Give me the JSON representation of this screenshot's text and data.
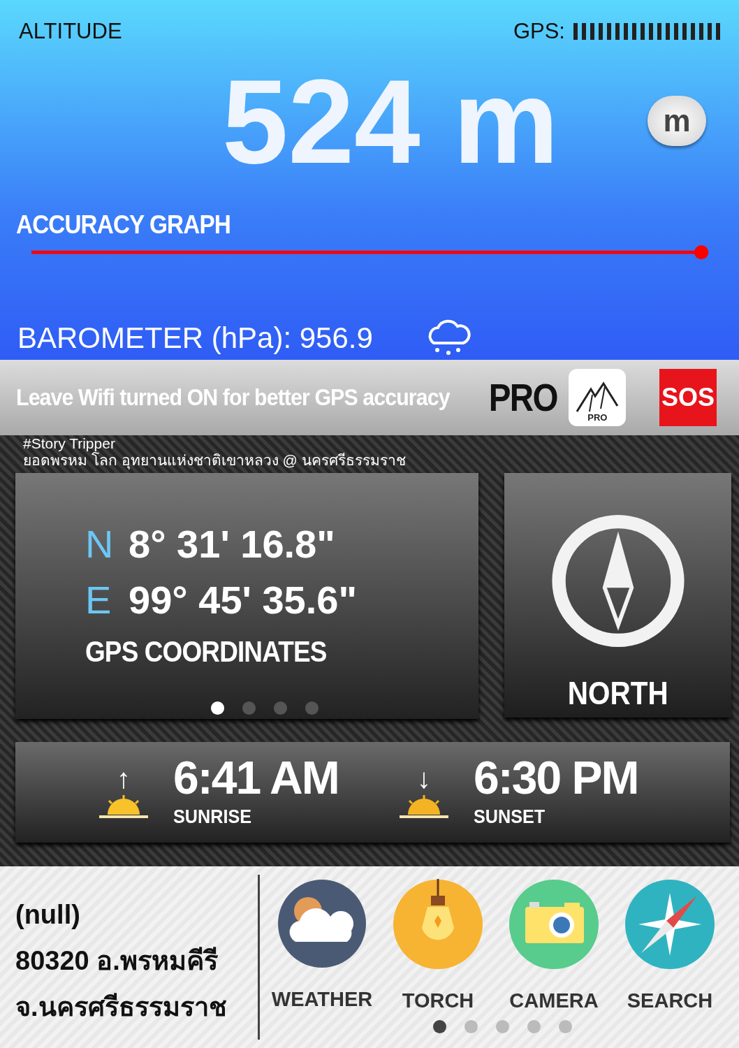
{
  "altitude": {
    "label": "ALTITUDE",
    "gps_label": "GPS:",
    "value": "524 m",
    "unit_button": "m"
  },
  "accuracy_graph": {
    "label": "ACCURACY GRAPH"
  },
  "barometer": {
    "label": "BAROMETER (hPa): 956.9"
  },
  "banner": {
    "text": "Leave Wifi turned ON for better GPS accuracy",
    "pro_label": "PRO",
    "pro_badge": "PRO",
    "sos_button": "SOS"
  },
  "caption": [
    "#Story Tripper",
    "ยอดพรหม โลก อุทยานแห่งชาติเขาหลวง @ นครศรีธรรมราช"
  ],
  "coordinates": {
    "rows": [
      {
        "axis": "N",
        "value": "8° 31' 16.8\""
      },
      {
        "axis": "E",
        "value": "99° 45' 35.6\""
      }
    ],
    "label": "GPS COORDINATES",
    "pages": [
      {
        "selected": true
      },
      {
        "selected": false
      },
      {
        "selected": false
      },
      {
        "selected": false
      }
    ]
  },
  "compass": {
    "label": "NORTH"
  },
  "sun": [
    {
      "kind": "rise",
      "arrow": "↑",
      "time": "6:41 AM",
      "label": "SUNRISE"
    },
    {
      "kind": "set",
      "arrow": "↓",
      "time": "6:30 PM",
      "label": "SUNSET"
    }
  ],
  "address": [
    "(null)",
    "80320 อ.พรหมคีรี",
    "จ.นครศรีธรรมราช"
  ],
  "apps": [
    {
      "kind": "weather",
      "label": "WEATHER"
    },
    {
      "kind": "torch",
      "label": "TORCH"
    },
    {
      "kind": "camera",
      "label": "CAMERA"
    },
    {
      "kind": "search",
      "label": "SEARCH"
    }
  ],
  "app_pages": [
    {
      "selected": true
    },
    {
      "selected": false
    },
    {
      "selected": false
    },
    {
      "selected": false
    },
    {
      "selected": false
    }
  ]
}
